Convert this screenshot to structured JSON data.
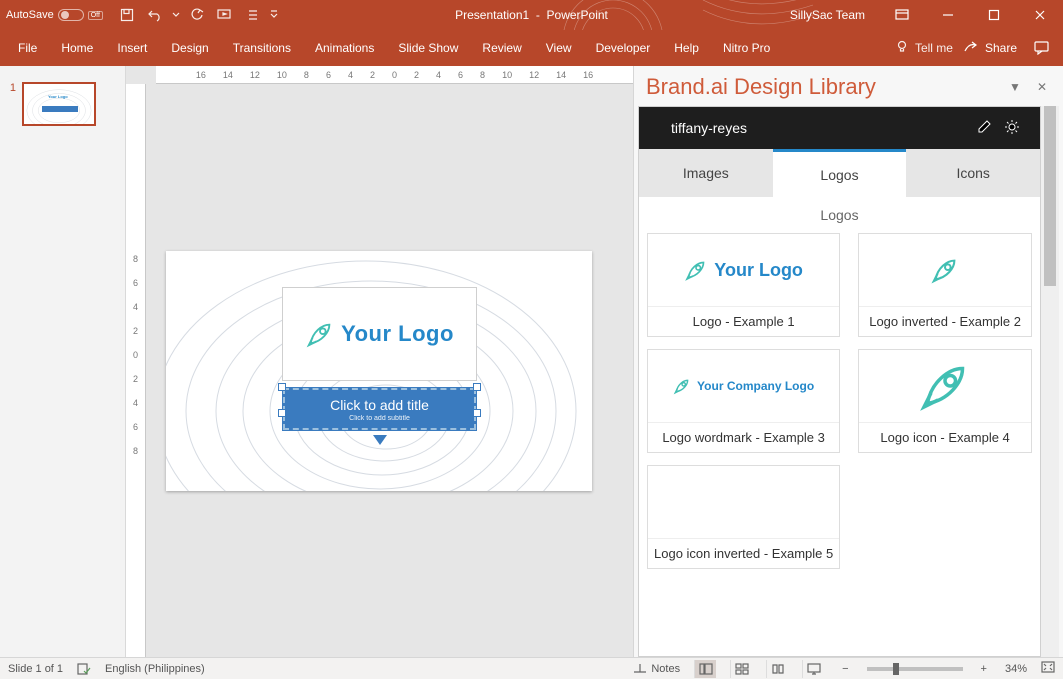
{
  "titlebar": {
    "autosave_label": "AutoSave",
    "autosave_state": "Off",
    "title_doc": "Presentation1",
    "title_app": "PowerPoint",
    "account": "SillySac Team"
  },
  "ribbon": {
    "tabs": [
      "File",
      "Home",
      "Insert",
      "Design",
      "Transitions",
      "Animations",
      "Slide Show",
      "Review",
      "View",
      "Developer",
      "Help",
      "Nitro Pro"
    ],
    "tellme": "Tell me",
    "share": "Share"
  },
  "ruler_h": [
    "16",
    "14",
    "12",
    "10",
    "8",
    "6",
    "4",
    "2",
    "0",
    "2",
    "4",
    "6",
    "8",
    "10",
    "12",
    "14",
    "16"
  ],
  "ruler_v": [
    "8",
    "6",
    "4",
    "2",
    "0",
    "2",
    "4",
    "6",
    "8"
  ],
  "thumbnail": {
    "index": "1"
  },
  "slide": {
    "logo_text": "Your Logo",
    "title_placeholder": "Click to add title",
    "subtitle_placeholder": "Click to add subtitle"
  },
  "pane": {
    "title": "Brand.ai Design Library",
    "user": "tiffany-reyes",
    "tabs": {
      "images": "Images",
      "logos": "Logos",
      "icons": "Icons"
    },
    "section_label": "Logos",
    "assets": [
      {
        "caption": "Logo - Example 1",
        "logo_text": "Your Logo"
      },
      {
        "caption": "Logo inverted - Example 2",
        "logo_text": ""
      },
      {
        "caption": "Logo wordmark - Example 3",
        "logo_text": "Your Company Logo"
      },
      {
        "caption": "Logo icon - Example 4",
        "logo_text": ""
      },
      {
        "caption": "Logo icon inverted - Example 5",
        "logo_text": ""
      }
    ]
  },
  "statusbar": {
    "slide": "Slide 1 of 1",
    "language": "English (Philippines)",
    "notes": "Notes",
    "zoom": "34%"
  }
}
